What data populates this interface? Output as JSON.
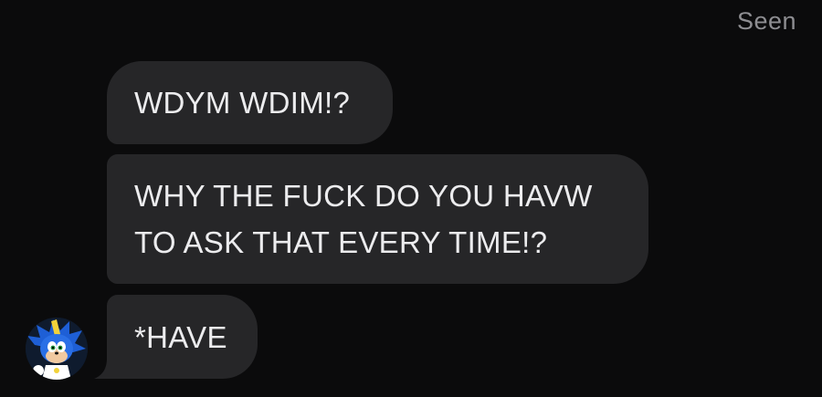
{
  "status": {
    "seen_label": "Seen"
  },
  "messages": [
    {
      "text": "WDYM WDIM!?"
    },
    {
      "text": "WHY THE FUCK DO YOU HAVW\nTO ASK THAT EVERY TIME!?"
    },
    {
      "text": "*HAVE"
    }
  ],
  "sender": {
    "avatar_icon": "sonic-character-avatar"
  },
  "colors": {
    "background": "#0b0b0c",
    "bubble": "#262628",
    "bubble_text": "#ececee",
    "seen_text": "#8e8e92"
  }
}
